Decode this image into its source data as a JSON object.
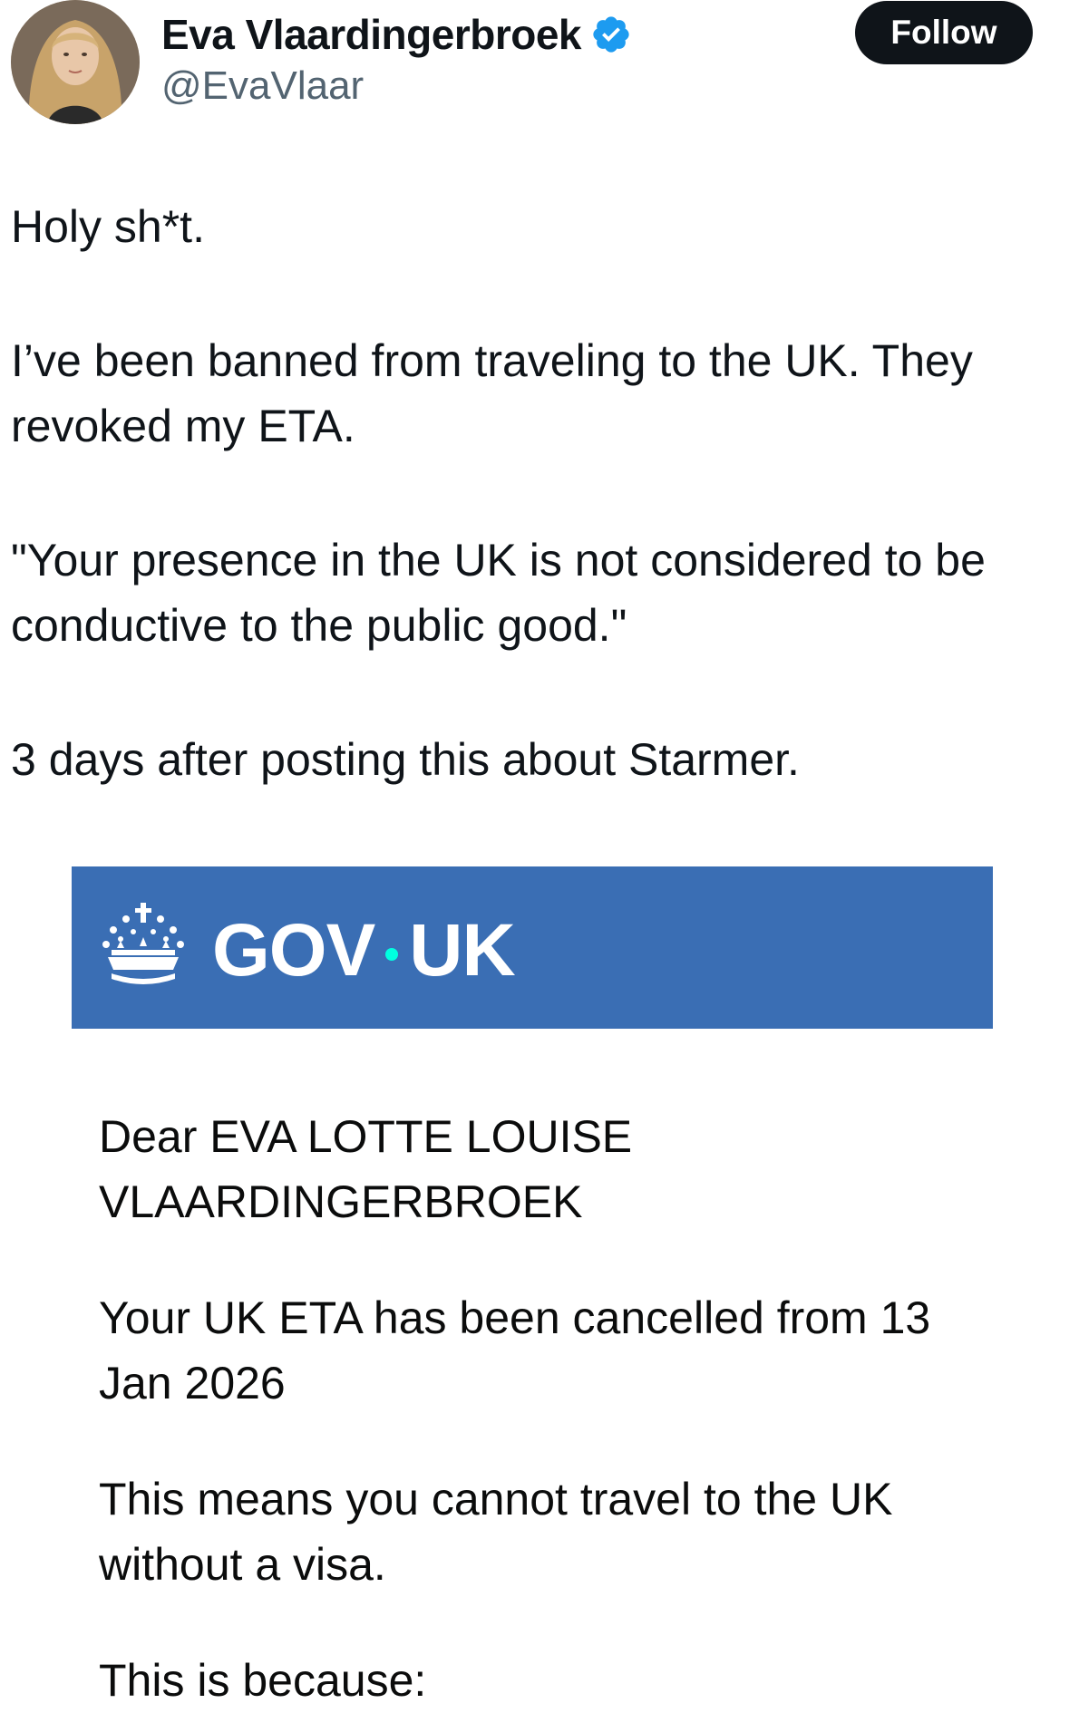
{
  "author": {
    "display_name": "Eva Vlaardingerbroek",
    "handle": "@EvaVlaar",
    "verified_icon": "verified-badge-icon",
    "follow_label": "Follow"
  },
  "tweet": {
    "paragraphs": [
      "Holy sh*t.",
      "I’ve been banned from traveling to the UK. They revoked my ETA.",
      "\"Your presence in the UK is not considered to be conductive to the public good.\"",
      "3 days after posting this about Starmer."
    ]
  },
  "attachment": {
    "banner": {
      "logo_left": "GOV",
      "logo_right": "UK",
      "crown_icon": "crown-icon",
      "banner_color": "#3a6eb4",
      "dot_color": "#00ffe0"
    },
    "letter": {
      "greeting": "Dear EVA LOTTE LOUISE VLAARDINGERBROEK",
      "line1": "Your UK ETA has been cancelled from 13 Jan 2026",
      "line2": "This means you cannot travel to the UK without a visa.",
      "line3": "This is because:"
    }
  },
  "colors": {
    "follow_button_bg": "#0f1419",
    "handle_text": "#536471",
    "verified_blue": "#1d9bf0"
  }
}
